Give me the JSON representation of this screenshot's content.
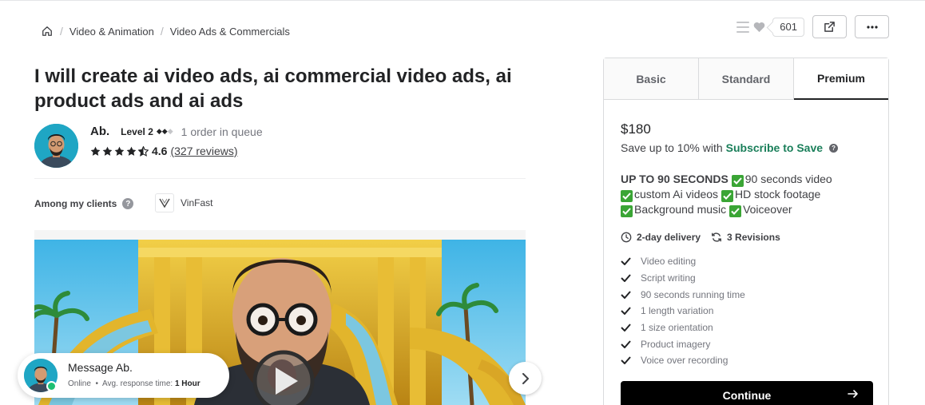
{
  "breadcrumb": {
    "items": [
      "Video & Animation",
      "Video Ads & Commercials"
    ]
  },
  "actions": {
    "likes_count": "601"
  },
  "gig": {
    "title": "I will create ai video ads, ai commercial video ads, ai product ads and ai ads"
  },
  "seller": {
    "name": "Ab.",
    "level": "Level 2",
    "queue": "1 order in queue",
    "rating": "4.6",
    "reviews": "(327 reviews)"
  },
  "clients": {
    "label": "Among my clients",
    "client_name": "VinFast"
  },
  "message": {
    "title": "Message Ab.",
    "status": "Online",
    "response_label": "Avg. response time:",
    "response_value": "1 Hour"
  },
  "packages": {
    "tabs": [
      "Basic",
      "Standard",
      "Premium"
    ],
    "active_tab": "Premium",
    "price": "$180",
    "save_prefix": "Save up to 10% with",
    "save_link": "Subscribe to Save",
    "desc_heading": "UP TO 90 SECONDS",
    "desc_items": [
      "90 seconds video",
      "custom Ai videos",
      "HD stock footage",
      "Background music",
      "Voiceover"
    ],
    "delivery": "2-day delivery",
    "revisions": "3 Revisions",
    "features": [
      "Video editing",
      "Script writing",
      "90 seconds running time",
      "1 length variation",
      "1 size orientation",
      "Product imagery",
      "Voice over recording"
    ],
    "continue_label": "Continue"
  },
  "colors": {
    "accent_green": "#1a7f5a",
    "check_green": "#3aa535",
    "online_green": "#1dbf73",
    "button_black": "#000000"
  }
}
